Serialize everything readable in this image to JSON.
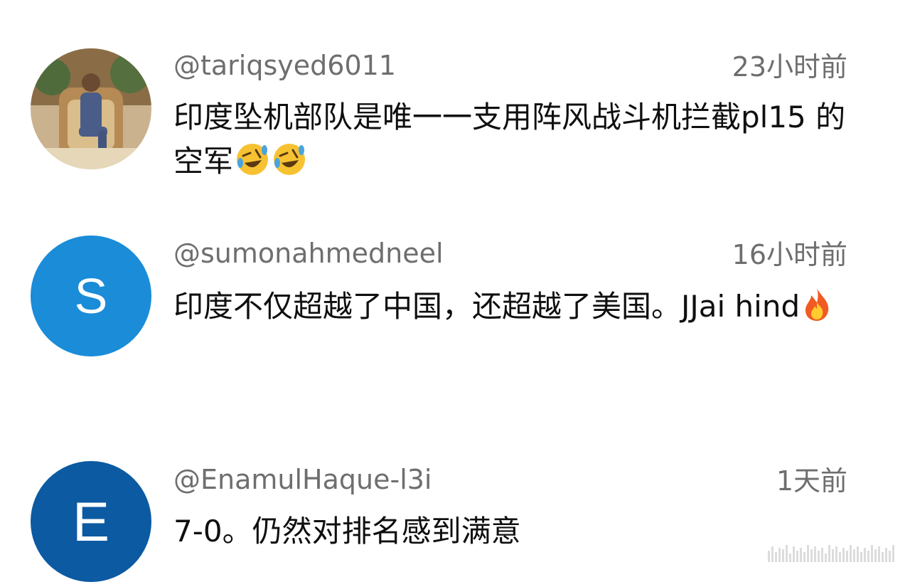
{
  "comments": [
    {
      "handle": "@tariqsyed6011",
      "time": "23小时前",
      "text": "印度坠机部队是唯一一支用阵风战斗机拦截pl15 的空军",
      "emojis": [
        "rolling-on-floor-laughing",
        "rolling-on-floor-laughing"
      ],
      "avatar": {
        "type": "photo"
      }
    },
    {
      "handle": "@sumonahmedneel",
      "time": "16小时前",
      "text": "印度不仅超越了中国，还超越了美国。JJai hind",
      "emojis": [
        "fire"
      ],
      "avatar": {
        "type": "letter",
        "letter": "S",
        "color": "#1a8cd8"
      }
    },
    {
      "handle": "@EnamulHaque-l3i",
      "time": "1天前",
      "text": "7-0。仍然对排名感到满意",
      "emojis": [],
      "avatar": {
        "type": "letter",
        "letter": "E",
        "color": "#0b5aa2"
      }
    }
  ]
}
